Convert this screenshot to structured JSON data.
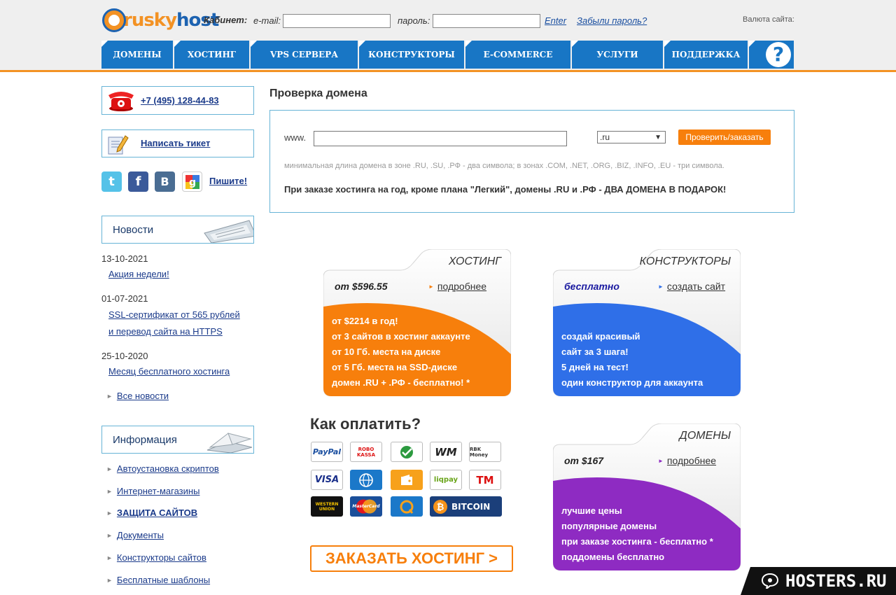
{
  "header": {
    "logo": {
      "part1": "rusky",
      "part2": "host"
    },
    "cabinet_label": "Кабинет:",
    "email_label": "e-mail:",
    "password_label": "пароль:",
    "enter_label": "Enter",
    "forgot_label": "Забыли пароль?",
    "currency_label": "Валюта сайта:"
  },
  "nav": [
    {
      "label": "ДОМЕНЫ"
    },
    {
      "label": "ХОСТИНГ"
    },
    {
      "label": "VPS СЕРВЕРА"
    },
    {
      "label": "КОНСТРУКТОРЫ"
    },
    {
      "label": "E-COMMERCE"
    },
    {
      "label": "УСЛУГИ"
    },
    {
      "label": "ПОДДЕРЖКА"
    }
  ],
  "nav_help_glyph": "?",
  "sidebar": {
    "phone": "+7 (495) 128-44-83",
    "ticket": "Написать тикет",
    "social_write": "Пишите!",
    "social_glyphs": {
      "vk": "B"
    },
    "news_title": "Новости",
    "news": [
      {
        "date": "13-10-2021",
        "lines": [
          "Акция недели!"
        ]
      },
      {
        "date": "01-07-2021",
        "lines": [
          "SSL-сертификат от 565 рублей",
          "и перевод сайта на HTTPS"
        ]
      },
      {
        "date": "25-10-2020",
        "lines": [
          "Месяц бесплатного хостинга"
        ]
      }
    ],
    "all_news": "Все новости",
    "info_title": "Информация",
    "info_links": [
      {
        "label": "Автоустановка скриптов"
      },
      {
        "label": "Интернет-магазины"
      },
      {
        "label": "ЗАЩИТА САЙТОВ"
      },
      {
        "label": "Документы"
      },
      {
        "label": "Конструкторы сайтов"
      },
      {
        "label": "Бесплатные шаблоны"
      }
    ]
  },
  "domain_check": {
    "title": "Проверка домена",
    "www_label": "www.",
    "zone_value": ".ru",
    "button": "Проверить/заказать",
    "hint": "минимальная длина домена в зоне .RU, .SU, .РФ - два символа; в зонах .COM, .NET, .ORG, .BIZ, .INFO, .EU - три символа.",
    "promo": "При заказе хостинга на год, кроме плана \"Легкий\", домены .RU и .РФ - ДВА ДОМЕНА В ПОДАРОК!"
  },
  "cards": {
    "hosting": {
      "title": "ХОСТИНГ",
      "price": "от $596.55",
      "link": "подробнее",
      "lines": [
        " от $2214 в год!",
        "от 3 сайтов в хостинг аккаунте",
        "от 10 Гб. места на диске",
        "от 5 Гб. места на SSD-диске",
        "домен .RU + .РФ - бесплатно! "
      ],
      "footnote": "*",
      "color": "#f77f0c"
    },
    "builders": {
      "title": "КОНСТРУКТОРЫ",
      "price": "бесплатно",
      "link": "создать сайт",
      "link_lines": [
        "создай красивый",
        "сайт за 3 шага!"
      ],
      "lines": [
        "5 дней на тест!",
        "один конструктор для аккаунта"
      ],
      "color": "#2f6fe8"
    },
    "domains": {
      "title": "ДОМЕНЫ",
      "price": "от $167",
      "link": "подробнее",
      "lines": [
        "лучшие цены",
        "популярные домены",
        "при заказе хостинга - бесплатно ",
        "поддомены бесплатно"
      ],
      "footnote": "*",
      "color": "#8e2bc2"
    }
  },
  "payment": {
    "title": "Как оплатить?",
    "methods": [
      {
        "label": "PayPal"
      },
      {
        "label": "ROBO KASSA"
      },
      {
        "label": "Сбербанк"
      },
      {
        "label": "WM"
      },
      {
        "label": "RBK Money"
      },
      {
        "label": "VISA"
      },
      {
        "label": "WebMoney"
      },
      {
        "label": "Яндекс"
      },
      {
        "label": "liqpay"
      },
      {
        "label": "TM"
      },
      {
        "label": "WESTERN UNION"
      },
      {
        "label": "MasterCard"
      },
      {
        "label": "QIWI"
      },
      {
        "label": "BITCOIN"
      }
    ]
  },
  "order_button": "ЗАКАЗАТЬ ХОСТИНГ >",
  "watermark": "HOSTERS.RU"
}
